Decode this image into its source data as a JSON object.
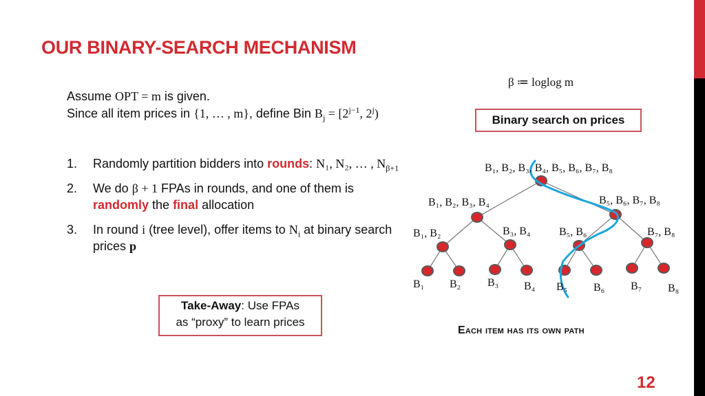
{
  "slide": {
    "title": "OUR BINARY-SEARCH MECHANISM",
    "page_number": "12",
    "accent_color": "#d22a30",
    "path_color": "#1aa7dd"
  },
  "intro": {
    "line1_pre": "Assume ",
    "line1_math": "OPT = m",
    "line1_post": " is given.",
    "line2_pre": "Since all item prices in ",
    "line2_math": "{1, … , m}",
    "line2_mid": ", define Bin ",
    "line2_bin": "B",
    "line2_bin_sub": "j",
    "line2_eq": " = [2",
    "line2_sup1": "j−1",
    "line2_comma": ", 2",
    "line2_sup2": "j",
    "line2_close": ")"
  },
  "beta_definition": "β ≔ loglog m",
  "binary_search_box": "Binary search on prices",
  "list": [
    {
      "num": "1.",
      "pre": "Randomly partition bidders into ",
      "highlight": "rounds",
      "post": ": ",
      "math": "N₁, N₂, … , N",
      "math_sub": "β+1"
    },
    {
      "num": "2.",
      "pre": "We do ",
      "math": "β + 1",
      "mid": " FPAs in rounds, and one of them is ",
      "highlight1": "randomly",
      "mid2": " the ",
      "highlight2": "final",
      "post": " allocation"
    },
    {
      "num": "3.",
      "pre": "In round ",
      "math_i": "i",
      "mid": " (tree level), offer items to ",
      "math_n": "N",
      "math_n_sub": "i",
      "post": " at binary search prices ",
      "math_p": "p"
    }
  ],
  "takeaway": {
    "label": "Take-Away",
    "text_line1": ": Use FPAs",
    "text_line2": "as “proxy” to learn prices"
  },
  "caption": "Each item has its own path",
  "tree": {
    "nodes": [
      {
        "id": "root",
        "label": "B₁, B₂, B₃, B₄, B₅, B₆, B₇, B₈"
      },
      {
        "id": "l1-left",
        "label": "B₁, B₂, B₃, B₄"
      },
      {
        "id": "l1-right",
        "label": "B₅, B₆, B₇, B₈"
      },
      {
        "id": "l2-b1b2",
        "label": "B₁, B₂"
      },
      {
        "id": "l2-b3b4",
        "label": "B₃, B₄"
      },
      {
        "id": "l2-b5b6",
        "label": "B₅, B₆"
      },
      {
        "id": "l2-b7b8",
        "label": "B₇, B₈"
      },
      {
        "id": "leaf-b1",
        "label": "B₁"
      },
      {
        "id": "leaf-b2",
        "label": "B₂"
      },
      {
        "id": "leaf-b3",
        "label": "B₃"
      },
      {
        "id": "leaf-b4",
        "label": "B₄"
      },
      {
        "id": "leaf-b5",
        "label": "B₅"
      },
      {
        "id": "leaf-b6",
        "label": "B₆"
      },
      {
        "id": "leaf-b7",
        "label": "B₇"
      },
      {
        "id": "leaf-b8",
        "label": "B₈"
      }
    ],
    "edges": [
      [
        "root",
        "l1-left"
      ],
      [
        "root",
        "l1-right"
      ],
      [
        "l1-left",
        "l2-b1b2"
      ],
      [
        "l1-left",
        "l2-b3b4"
      ],
      [
        "l1-right",
        "l2-b5b6"
      ],
      [
        "l1-right",
        "l2-b7b8"
      ],
      [
        "l2-b1b2",
        "leaf-b1"
      ],
      [
        "l2-b1b2",
        "leaf-b2"
      ],
      [
        "l2-b3b4",
        "leaf-b3"
      ],
      [
        "l2-b3b4",
        "leaf-b4"
      ],
      [
        "l2-b5b6",
        "leaf-b5"
      ],
      [
        "l2-b5b6",
        "leaf-b6"
      ],
      [
        "l2-b7b8",
        "leaf-b7"
      ],
      [
        "l2-b7b8",
        "leaf-b8"
      ]
    ],
    "highlighted_path": [
      "root",
      "l1-right",
      "l2-b5b6",
      "leaf-b5"
    ],
    "node_fill": "#d9262b",
    "node_stroke": "#5a5a5a",
    "edge_color": "#777777"
  }
}
